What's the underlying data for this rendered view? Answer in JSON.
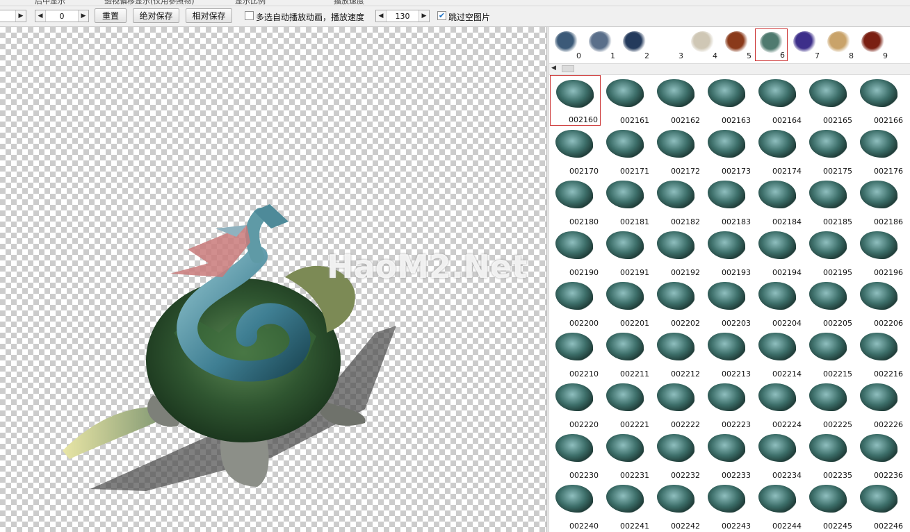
{
  "topstrip": {
    "texts": [
      "后中显示",
      "透视偏移显示(仅用参照物)",
      "显示比例",
      "播放速度"
    ]
  },
  "toolbar": {
    "spin1_value": "",
    "spin2_value": "0",
    "reset_label": "重置",
    "abs_save_label": "绝对保存",
    "rel_save_label": "相对保存",
    "multi_autoplay_label": "多选自动播放动画，播放速度",
    "multi_autoplay_checked": false,
    "speed_value": "130",
    "skip_empty_label": "跳过空图片",
    "skip_empty_checked": true
  },
  "watermark": "HaoM2.Net",
  "libraries": [
    {
      "label": "0",
      "color": "#3c5a78"
    },
    {
      "label": "1",
      "color": "#5a6f8a"
    },
    {
      "label": "2",
      "color": "#243a5c"
    },
    {
      "label": "3",
      "color": "#ffffff"
    },
    {
      "label": "4",
      "color": "#cfc7b5"
    },
    {
      "label": "5",
      "color": "#8a3a1a"
    },
    {
      "label": "6",
      "color": "#4f7a6f",
      "selected": true
    },
    {
      "label": "7",
      "color": "#3d2f8a"
    },
    {
      "label": "8",
      "color": "#c9a36a"
    },
    {
      "label": "9",
      "color": "#7a1f12"
    }
  ],
  "frames": [
    [
      "002160",
      "002161",
      "002162",
      "002163",
      "002164",
      "002165",
      "002166"
    ],
    [
      "002170",
      "002171",
      "002172",
      "002173",
      "002174",
      "002175",
      "002176"
    ],
    [
      "002180",
      "002181",
      "002182",
      "002183",
      "002184",
      "002185",
      "002186"
    ],
    [
      "002190",
      "002191",
      "002192",
      "002193",
      "002194",
      "002195",
      "002196"
    ],
    [
      "002200",
      "002201",
      "002202",
      "002203",
      "002204",
      "002205",
      "002206"
    ],
    [
      "002210",
      "002211",
      "002212",
      "002213",
      "002214",
      "002215",
      "002216"
    ],
    [
      "002220",
      "002221",
      "002222",
      "002223",
      "002224",
      "002225",
      "002226"
    ],
    [
      "002230",
      "002231",
      "002232",
      "002233",
      "002234",
      "002235",
      "002236"
    ],
    [
      "002240",
      "002241",
      "002242",
      "002243",
      "002244",
      "002245",
      "002246"
    ]
  ],
  "selected_frame": "002160",
  "colors": {
    "selection": "#cc3333",
    "checkbox_accent": "#1a6fc4"
  }
}
